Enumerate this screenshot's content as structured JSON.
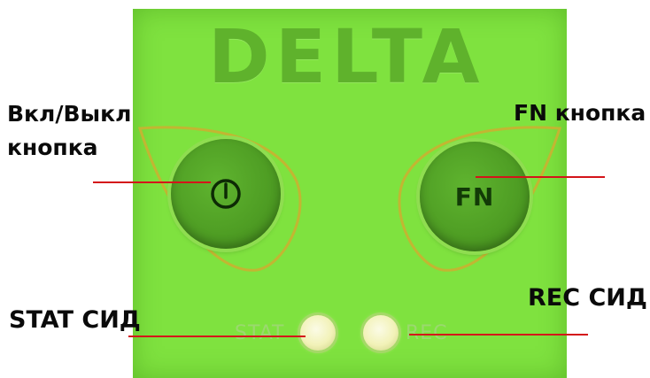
{
  "panel": {
    "brand": "DELTA",
    "background_color": "#7fe23f",
    "power_button": {
      "icon": "power-icon"
    },
    "fn_button": {
      "label": "FN"
    },
    "leds": {
      "stat_label": "STAT",
      "rec_label": "REC"
    }
  },
  "callouts": {
    "power_line1": "Вкл/Выкл",
    "power_line2": "кнопка",
    "fn": "FN кнопка",
    "stat": "STAT СИД",
    "rec": "REC СИД"
  },
  "leader_color": "#d4141a"
}
